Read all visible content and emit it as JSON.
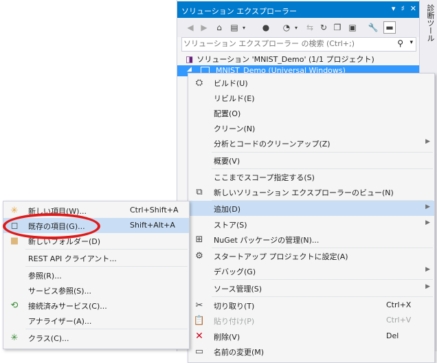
{
  "solution_explorer": {
    "title": "ソリューション エクスプローラー",
    "title_buttons": [
      "▾",
      "♯",
      "✕"
    ],
    "search_placeholder": "ソリューション エクスプローラー の検索 (Ctrl+;)",
    "solution_label": "ソリューション 'MNIST_Demo' (1/1 プロジェクト)",
    "project_label": "MNIST_Demo (Universal Windows)"
  },
  "right_tab": {
    "label": "診断ツール"
  },
  "main_menu": {
    "items": [
      {
        "label": "ビルド(U)"
      },
      {
        "label": "リビルド(E)"
      },
      {
        "label": "配置(O)"
      },
      {
        "label": "クリーン(N)"
      },
      {
        "label": "分析とコードのクリーンアップ(Z)"
      },
      {
        "label": "概要(V)"
      },
      {
        "label": "ここまでスコープ指定する(S)"
      },
      {
        "label": "新しいソリューション エクスプローラーのビュー(N)"
      },
      {
        "label": "追加(D)"
      },
      {
        "label": "ストア(S)"
      },
      {
        "label": "NuGet パッケージの管理(N)..."
      },
      {
        "label": "スタートアップ プロジェクトに設定(A)"
      },
      {
        "label": "デバッグ(G)"
      },
      {
        "label": "ソース管理(S)"
      },
      {
        "label": "切り取り(T)",
        "shortcut": "Ctrl+X"
      },
      {
        "label": "貼り付け(P)",
        "shortcut": "Ctrl+V"
      },
      {
        "label": "削除(V)",
        "shortcut": "Del"
      },
      {
        "label": "名前の変更(M)"
      }
    ]
  },
  "add_menu": {
    "items": [
      {
        "label": "新しい項目(W)...",
        "shortcut": "Ctrl+Shift+A"
      },
      {
        "label": "既存の項目(G)...",
        "shortcut": "Shift+Alt+A"
      },
      {
        "label": "新しいフォルダー(D)"
      },
      {
        "label": "REST API クライアント..."
      },
      {
        "label": "参照(R)..."
      },
      {
        "label": "サービス参照(S)..."
      },
      {
        "label": "接続済みサービス(C)..."
      },
      {
        "label": "アナライザー(A)..."
      },
      {
        "label": "クラス(C)..."
      }
    ]
  },
  "colors": {
    "title_bar": "#007acc",
    "selection": "#3399ff",
    "menu_highlight": "#c9def5",
    "annotation": "#e01a1a"
  }
}
